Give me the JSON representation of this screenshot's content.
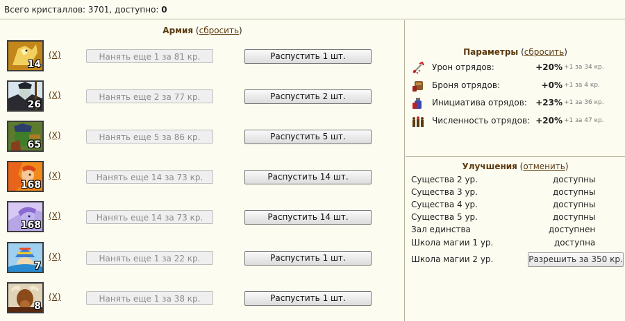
{
  "top": {
    "label": "Всего кристаллов: 3701, доступно: ",
    "available": "0"
  },
  "army": {
    "title": "Армия",
    "reset": "сбросить",
    "open_paren": " (",
    "close_paren": ")",
    "units": [
      {
        "portrait": "griffin-portrait-icon",
        "count": "14",
        "remove": "(X)",
        "hire": "Нанять еще 1 за 81 кр.",
        "dismiss": "Распустить 1 шт."
      },
      {
        "portrait": "vampire-portrait-icon",
        "count": "26",
        "remove": "(X)",
        "hire": "Нанять еще 2 за 77 кр.",
        "dismiss": "Распустить 2 шт."
      },
      {
        "portrait": "orc-warrior-portrait-icon",
        "count": "65",
        "remove": "(X)",
        "hire": "Нанять еще 5 за 86 кр.",
        "dismiss": "Распустить 5 шт."
      },
      {
        "portrait": "sprite-portrait-icon",
        "count": "168",
        "remove": "(X)",
        "hire": "Нанять еще 14 за 73 кр.",
        "dismiss": "Распустить 14 шт."
      },
      {
        "portrait": "fairy-portrait-icon",
        "count": "168",
        "remove": "(X)",
        "hire": "Нанять еще 14 за 73 кр.",
        "dismiss": "Распустить 14 шт."
      },
      {
        "portrait": "mage-portrait-icon",
        "count": "7",
        "remove": "(X)",
        "hire": "Нанять еще 1 за 22 кр.",
        "dismiss": "Распустить 1 шт."
      },
      {
        "portrait": "minotaur-portrait-icon",
        "count": "8",
        "remove": "(X)",
        "hire": "Нанять еще 1 за 38 кр.",
        "dismiss": "Распустить 1 шт."
      }
    ]
  },
  "params": {
    "title": "Параметры",
    "reset": "сбросить",
    "open_paren": " (",
    "close_paren": ")",
    "rows": [
      {
        "icon": "damage-icon",
        "label": "Урон отрядов:",
        "value": "+20%",
        "note": "+1 за 34 кр."
      },
      {
        "icon": "armor-icon",
        "label": "Броня отрядов:",
        "value": "+0%",
        "note": "+1 за 4 кр."
      },
      {
        "icon": "initiative-icon",
        "label": "Инициатива отрядов:",
        "value": "+23%",
        "note": "+1 за 36 кр."
      },
      {
        "icon": "troop-size-icon",
        "label": "Численность отрядов:",
        "value": "+20%",
        "note": "+1 за 47 кр."
      }
    ]
  },
  "upgrades": {
    "title": "Улучшения",
    "cancel": "отменить",
    "open_paren": " (",
    "close_paren": ")",
    "rows": [
      {
        "name": "Существа 2 ур.",
        "status": "доступны"
      },
      {
        "name": "Существа 3 ур.",
        "status": "доступны"
      },
      {
        "name": "Существа 4 ур.",
        "status": "доступны"
      },
      {
        "name": "Существа 5 ур.",
        "status": "доступны"
      },
      {
        "name": "Зал единства",
        "status": "доступнен"
      },
      {
        "name": "Школа магии 1 ур.",
        "status": "доступна"
      }
    ],
    "last": {
      "name": "Школа магии 2 ур.",
      "button": "Разрешить за 350 кр."
    }
  },
  "colors": {
    "background": "#fdfcf0",
    "title_brown": "#5a3a10",
    "divider": "#b9b39a"
  }
}
